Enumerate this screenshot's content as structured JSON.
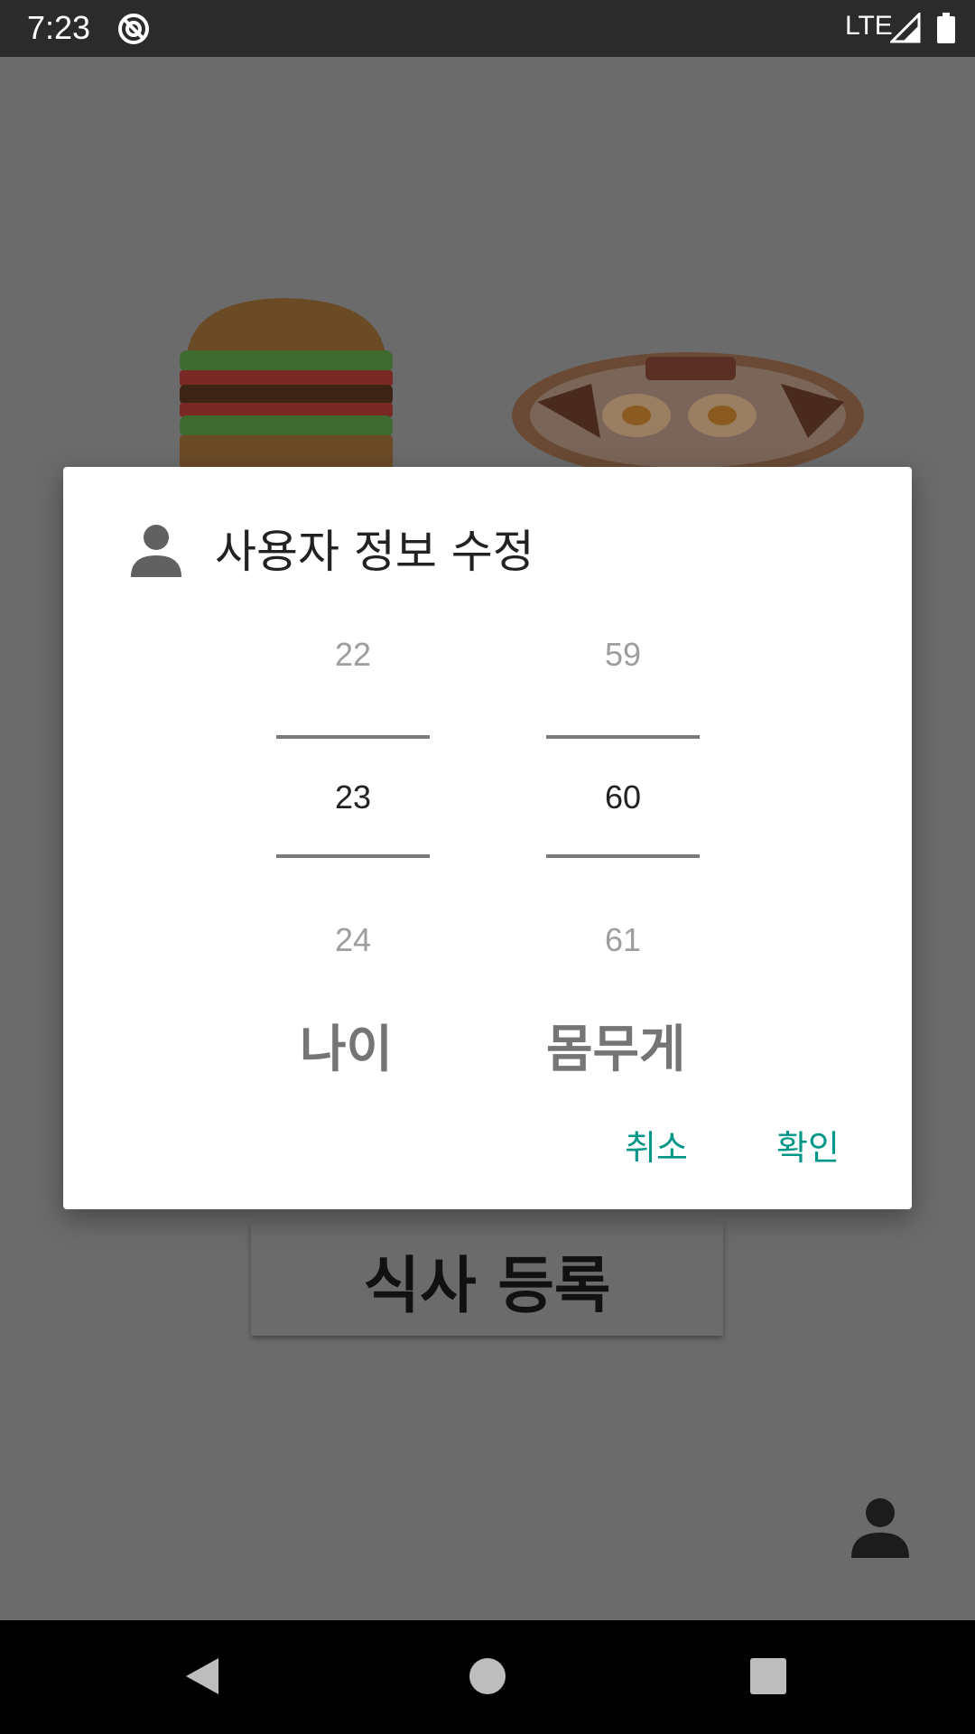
{
  "status_bar": {
    "time": "7:23",
    "network": "LTE",
    "icons": [
      "do-not-disturb-icon",
      "signal-icon",
      "battery-icon"
    ]
  },
  "background": {
    "meal_button_label": "식사 등록",
    "images": [
      "burger-image",
      "breakfast-plate-image"
    ],
    "profile_icon": "person-icon"
  },
  "dialog": {
    "title": "사용자 정보 수정",
    "title_icon": "person-icon",
    "age_picker": {
      "prev": "22",
      "selected": "23",
      "next": "24",
      "label": "나이"
    },
    "weight_picker": {
      "prev": "59",
      "selected": "60",
      "next": "61",
      "label": "몸무게"
    },
    "cancel_label": "취소",
    "confirm_label": "확인",
    "accent_color": "#009688"
  },
  "nav_bar": {
    "icons": [
      "back-icon",
      "home-icon",
      "recents-icon"
    ]
  }
}
